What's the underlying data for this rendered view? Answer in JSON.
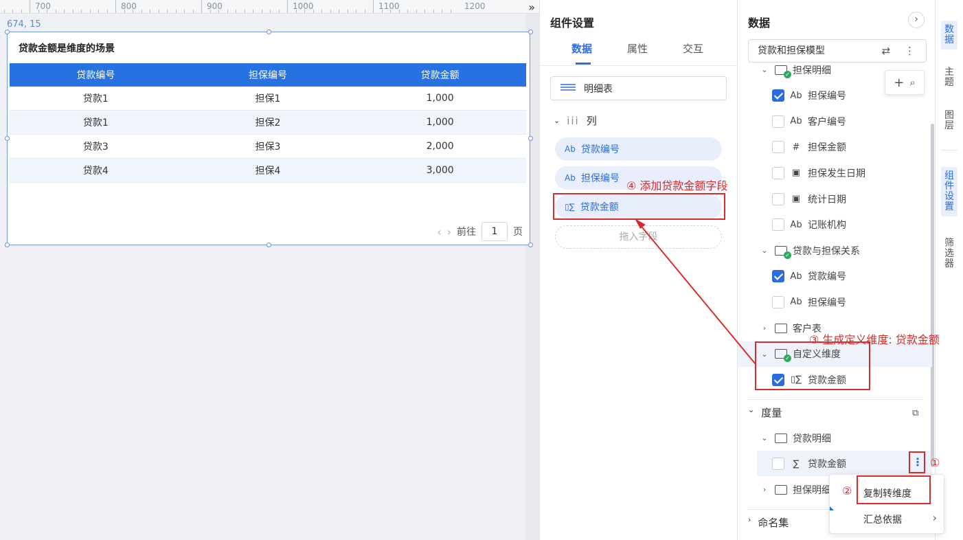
{
  "canvas": {
    "ruler_labels": [
      "700",
      "800",
      "900",
      "1000",
      "1100",
      "1200"
    ],
    "ruler_arrow": "»",
    "coord": "674, 15",
    "widget_title": "贷款金额是维度的场景",
    "table": {
      "headers": [
        "贷款编号",
        "担保编号",
        "贷款金额"
      ],
      "rows": [
        [
          "贷款1",
          "担保1",
          "1,000"
        ],
        [
          "贷款1",
          "担保2",
          "1,000"
        ],
        [
          "贷款3",
          "担保3",
          "2,000"
        ],
        [
          "贷款4",
          "担保4",
          "3,000"
        ]
      ]
    },
    "pager": {
      "prev": "‹",
      "next": "›",
      "goto_label": "前往",
      "page": "1",
      "page_suffix": "页"
    }
  },
  "settings": {
    "title": "组件设置",
    "tabs": [
      "数据",
      "属性",
      "交互"
    ],
    "chart_type": "明细表",
    "columns_label": "列",
    "columns_icon": "iii",
    "fields": [
      {
        "icon": "Ab",
        "label": "贷款编号"
      },
      {
        "icon": "Ab",
        "label": "担保编号"
      },
      {
        "icon": "▯∑",
        "label": "贷款金额"
      }
    ],
    "drop_placeholder": "拖入字段"
  },
  "data_panel": {
    "title": "数据",
    "collapse_icon": "›",
    "model": "贷款和担保模型",
    "model_icons": "⇄ ⋮",
    "tools": [
      "+",
      "⌕"
    ],
    "tree": [
      {
        "type": "folder",
        "label": "担保明细",
        "indent": 1,
        "ok": true
      },
      {
        "type": "field",
        "icon": "Ab",
        "label": "担保编号",
        "checked": true
      },
      {
        "type": "field",
        "icon": "Ab",
        "label": "客户编号",
        "checked": false
      },
      {
        "type": "field",
        "icon": "#",
        "label": "担保金额",
        "checked": false
      },
      {
        "type": "field",
        "icon": "▣",
        "label": "担保发生日期",
        "checked": false
      },
      {
        "type": "field",
        "icon": "▣",
        "label": "统计日期",
        "checked": false
      },
      {
        "type": "field",
        "icon": "Ab",
        "label": "记账机构",
        "checked": false
      },
      {
        "type": "folder",
        "label": "贷款与担保关系",
        "ok": true,
        "open": true
      },
      {
        "type": "field",
        "icon": "Ab",
        "label": "贷款编号",
        "checked": true
      },
      {
        "type": "field",
        "icon": "Ab",
        "label": "担保编号",
        "checked": false
      },
      {
        "type": "folder",
        "label": "客户表",
        "ok": false,
        "open": false
      },
      {
        "type": "folder",
        "label": "自定义维度",
        "ok": true,
        "open": true,
        "hl": true
      },
      {
        "type": "field",
        "icon": "▯∑",
        "label": "贷款金额",
        "checked": true
      }
    ],
    "measure_label": "度量",
    "measure_icon": "⧉",
    "measure_tree": [
      {
        "type": "folder",
        "label": "贷款明细",
        "open": true
      },
      {
        "type": "field",
        "icon": "∑",
        "label": "贷款金额",
        "checked": false
      },
      {
        "type": "folder",
        "label": "担保明细",
        "open": false
      }
    ],
    "named_set_label": "命名集",
    "more_icon": "⋮"
  },
  "side_tabs": [
    "数据",
    "主题",
    "图层",
    "组件设置",
    "筛选器"
  ],
  "context_menu": {
    "items": [
      "复制转维度",
      "汇总依据"
    ],
    "submenu_arrow": "›"
  },
  "annotations": {
    "a1": "①",
    "a2": "②",
    "a3": "③ 生成定义维度: 贷款金额",
    "a4": "④ 添加贷款金额字段"
  },
  "colors": {
    "accent": "#2d6ce0",
    "table_header": "#2672e0",
    "annotation": "#d92b2b"
  }
}
